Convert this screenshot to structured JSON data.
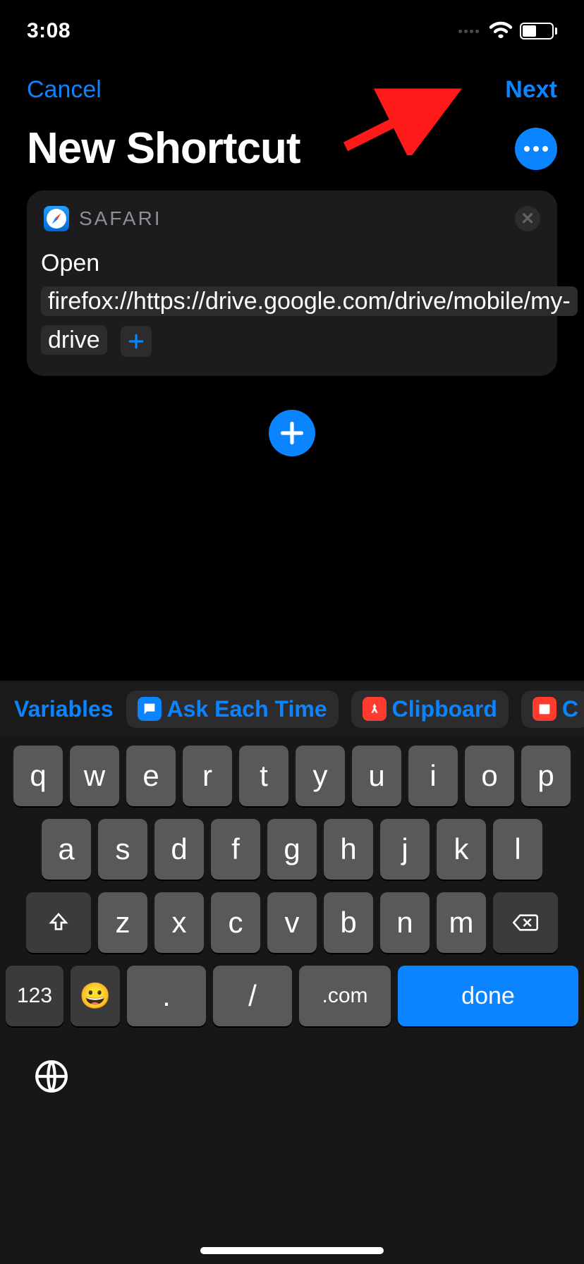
{
  "status": {
    "time": "3:08"
  },
  "nav": {
    "cancel": "Cancel",
    "next": "Next"
  },
  "page": {
    "title": "New Shortcut"
  },
  "action": {
    "app": "SAFARI",
    "verb": "Open",
    "url": "firefox://https://drive.google.com/drive/mobile/my-drive"
  },
  "suggestions": {
    "variables": "Variables",
    "ask": "Ask Each Time",
    "clipboard": "Clipboard",
    "current": "C"
  },
  "keyboard": {
    "row1": [
      "q",
      "w",
      "e",
      "r",
      "t",
      "y",
      "u",
      "i",
      "o",
      "p"
    ],
    "row2": [
      "a",
      "s",
      "d",
      "f",
      "g",
      "h",
      "j",
      "k",
      "l"
    ],
    "row3": [
      "z",
      "x",
      "c",
      "v",
      "b",
      "n",
      "m"
    ],
    "num": "123",
    "dot": ".",
    "slash": "/",
    "com": ".com",
    "done": "done"
  }
}
